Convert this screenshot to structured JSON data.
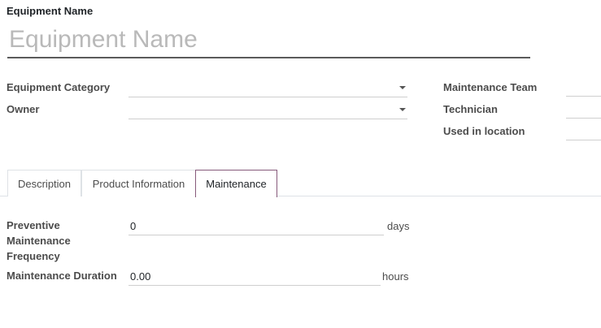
{
  "form": {
    "name_label": "Equipment Name",
    "name_placeholder": "Equipment Name",
    "name_value": ""
  },
  "left_fields": [
    {
      "label": "Equipment Category",
      "value": ""
    },
    {
      "label": "Owner",
      "value": ""
    }
  ],
  "right_fields": [
    {
      "label": "Maintenance Team",
      "value": ""
    },
    {
      "label": "Technician",
      "value": ""
    },
    {
      "label": "Used in location",
      "value": ""
    }
  ],
  "tabs": [
    {
      "label": "Description",
      "active": false
    },
    {
      "label": "Product Information",
      "active": false
    },
    {
      "label": "Maintenance",
      "active": true
    }
  ],
  "maintenance": {
    "frequency_label_1": "Preventive",
    "frequency_label_2": "Maintenance",
    "frequency_label_3": "Frequency",
    "frequency_value": "0",
    "frequency_unit": "days",
    "duration_label": "Maintenance Duration",
    "duration_value": "0.00",
    "duration_unit": "hours"
  },
  "colors": {
    "accent": "#875A7B",
    "label": "#4c4c4c",
    "border": "#cfcfcf"
  }
}
